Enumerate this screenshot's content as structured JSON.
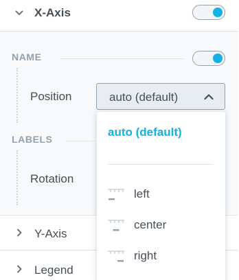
{
  "colors": {
    "accent": "#14b2e2",
    "text": "#464e56",
    "muted": "#94a1ad",
    "border": "#dde4eb",
    "panel_bg": "#f7f9fa"
  },
  "sections": {
    "x_axis": {
      "title": "X-Axis",
      "enabled": true,
      "expanded": true,
      "icon": "chevron-down-icon"
    },
    "y_axis": {
      "title": "Y-Axis",
      "expanded": false,
      "icon": "chevron-right-icon"
    },
    "legend": {
      "title": "Legend",
      "expanded": false,
      "icon": "chevron-right-icon"
    }
  },
  "x_axis_body": {
    "name_group": {
      "label": "NAME",
      "enabled": true
    },
    "position_label": "Position",
    "position_value": "auto (default)",
    "labels_group": {
      "label": "LABELS"
    },
    "rotation_label": "Rotation"
  },
  "dropdown": {
    "selected": "auto (default)",
    "options": [
      {
        "label": "left",
        "icon": "align-left-icon"
      },
      {
        "label": "center",
        "icon": "align-center-icon"
      },
      {
        "label": "right",
        "icon": "align-right-icon"
      }
    ]
  }
}
